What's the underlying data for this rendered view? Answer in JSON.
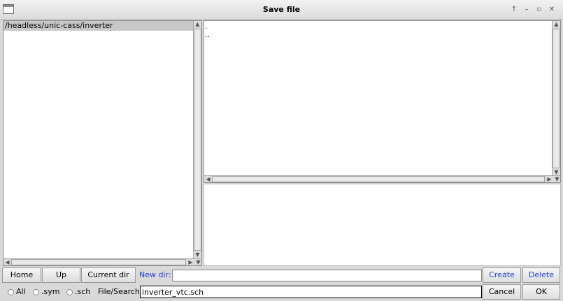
{
  "window": {
    "title": "Save file",
    "controls": [
      "↑",
      "–",
      "▫",
      "✕"
    ]
  },
  "dir_list": {
    "items": [
      "/headless/unic-cass/inverter"
    ]
  },
  "file_list": {
    "items": [
      ".",
      ".."
    ]
  },
  "buttons": {
    "home": "Home",
    "up": "Up",
    "current_dir": "Current dir",
    "create": "Create",
    "delete": "Delete",
    "cancel": "Cancel",
    "ok": "OK"
  },
  "new_dir": {
    "label": "New dir:",
    "value": ""
  },
  "filters": [
    {
      "label": "All"
    },
    {
      "label": ".sym"
    },
    {
      "label": ".sch"
    }
  ],
  "file_search": {
    "label": "File/Search:",
    "value": "inverter_vtc.sch"
  },
  "colors": {
    "accent_text": "#1f3fd6",
    "selected_row": "#c8c8c8"
  }
}
